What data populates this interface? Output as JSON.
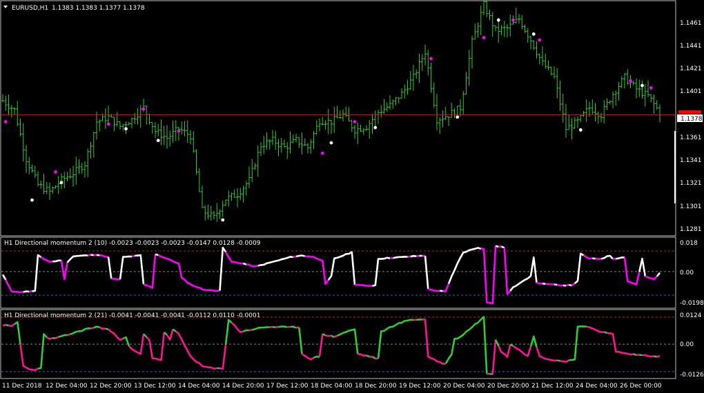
{
  "colors": {
    "background": "#000000",
    "frame": "#c0c0c0",
    "text": "#ffffff",
    "bar": "#32cd32",
    "marker_magenta": "#ff00ff",
    "marker_white": "#ffffff",
    "price_line": "#ff0000",
    "price_label_bg": "#ffffff",
    "dm10_up": "#ffffff",
    "dm10_down": "#ff00ff",
    "dm21_up": "#32cd32",
    "dm21_down": "#ff1493",
    "band_upper": "#ff3333",
    "band_lower": "#1e90ff",
    "zero_line": "#c0c0c0"
  },
  "icons": {
    "menu": "triangle-down-icon"
  },
  "main": {
    "symbol_label": "EURUSD,H1",
    "ohlc": "1.1383 1.1383 1.1377 1.1378",
    "current_price": "1.1378",
    "price_ticks": [
      "1.1461",
      "1.1441",
      "1.1421",
      "1.1401",
      "1.1361",
      "1.1341",
      "1.1321",
      "1.1301",
      "1.1281"
    ]
  },
  "sub1": {
    "title": "H1 Directional momentum 2 (10) -0.0023 -0.0023 -0.0023 -0.0147 0.0128 -0.0009",
    "ticks": [
      "0.018",
      "0.00",
      "-0.0198"
    ]
  },
  "sub2": {
    "title": "H1 Directional momentum 2 (21) -0.0041 -0.0041 -0.0041 -0.0112 0.0110 -0.0001",
    "ticks": [
      "0.0124",
      "0.00",
      "-0.0126"
    ]
  },
  "time_axis": [
    "11 Dec 2018",
    "12 Dec 04:00",
    "12 Dec 20:00",
    "13 Dec 12:00",
    "14 Dec 04:00",
    "14 Dec 20:00",
    "17 Dec 12:00",
    "18 Dec 04:00",
    "18 Dec 20:00",
    "19 Dec 12:00",
    "20 Dec 04:00",
    "20 Dec 20:00",
    "21 Dec 12:00",
    "24 Dec 04:00",
    "26 Dec 00:00"
  ],
  "chart_data": [
    {
      "type": "ohlc",
      "symbol": "EURUSD",
      "timeframe": "H1",
      "ylim": [
        1.1275,
        1.1475
      ],
      "x_tick_labels": [
        "11 Dec 2018",
        "12 Dec 04:00",
        "12 Dec 20:00",
        "13 Dec 12:00",
        "14 Dec 04:00",
        "14 Dec 20:00",
        "17 Dec 12:00",
        "18 Dec 04:00",
        "18 Dec 20:00",
        "19 Dec 12:00",
        "20 Dec 04:00",
        "20 Dec 20:00",
        "21 Dec 12:00",
        "24 Dec 04:00",
        "26 Dec 00:00"
      ],
      "y_tick_labels": [
        "1.1461",
        "1.1441",
        "1.1421",
        "1.1401",
        "1.1361",
        "1.1341",
        "1.1321",
        "1.1301",
        "1.1281"
      ],
      "current_price": 1.1378,
      "path_close": [
        [
          0,
          1.139
        ],
        [
          4,
          1.1382
        ],
        [
          8,
          1.134
        ],
        [
          12,
          1.1318
        ],
        [
          16,
          1.1312
        ],
        [
          20,
          1.1322
        ],
        [
          24,
          1.1328
        ],
        [
          28,
          1.1336
        ],
        [
          32,
          1.1372
        ],
        [
          36,
          1.1376
        ],
        [
          40,
          1.1368
        ],
        [
          44,
          1.1374
        ],
        [
          48,
          1.1384
        ],
        [
          52,
          1.1364
        ],
        [
          56,
          1.1358
        ],
        [
          60,
          1.1366
        ],
        [
          64,
          1.136
        ],
        [
          68,
          1.1296
        ],
        [
          72,
          1.129
        ],
        [
          76,
          1.1306
        ],
        [
          80,
          1.131
        ],
        [
          84,
          1.1322
        ],
        [
          88,
          1.1352
        ],
        [
          92,
          1.1356
        ],
        [
          96,
          1.135
        ],
        [
          100,
          1.1356
        ],
        [
          104,
          1.135
        ],
        [
          108,
          1.1373
        ],
        [
          112,
          1.1372
        ],
        [
          116,
          1.1378
        ],
        [
          120,
          1.1365
        ],
        [
          124,
          1.1368
        ],
        [
          128,
          1.138
        ],
        [
          132,
          1.1386
        ],
        [
          136,
          1.1396
        ],
        [
          140,
          1.141
        ],
        [
          144,
          1.1432
        ],
        [
          148,
          1.1374
        ],
        [
          152,
          1.1378
        ],
        [
          156,
          1.1384
        ],
        [
          160,
          1.144
        ],
        [
          164,
          1.1472
        ],
        [
          168,
          1.145
        ],
        [
          172,
          1.1452
        ],
        [
          176,
          1.146
        ],
        [
          180,
          1.1442
        ],
        [
          184,
          1.1422
        ],
        [
          188,
          1.141
        ],
        [
          192,
          1.1366
        ],
        [
          196,
          1.1372
        ],
        [
          200,
          1.1384
        ],
        [
          204,
          1.1378
        ],
        [
          208,
          1.1396
        ],
        [
          212,
          1.141
        ],
        [
          216,
          1.14
        ],
        [
          220,
          1.1394
        ],
        [
          224,
          1.138
        ]
      ],
      "markers": [
        {
          "type": "magenta",
          "bar": 1,
          "price": 1.1372
        },
        {
          "type": "white",
          "bar": 10,
          "price": 1.1305
        },
        {
          "type": "magenta",
          "bar": 18,
          "price": 1.1329
        },
        {
          "type": "white",
          "bar": 20,
          "price": 1.132
        },
        {
          "type": "magenta",
          "bar": 36,
          "price": 1.137
        },
        {
          "type": "white",
          "bar": 42,
          "price": 1.1366
        },
        {
          "type": "magenta",
          "bar": 48,
          "price": 1.1383
        },
        {
          "type": "white",
          "bar": 53,
          "price": 1.1356
        },
        {
          "type": "magenta",
          "bar": 60,
          "price": 1.1364
        },
        {
          "type": "white",
          "bar": 75,
          "price": 1.1288
        },
        {
          "type": "white",
          "bar": 112,
          "price": 1.1354
        },
        {
          "type": "magenta",
          "bar": 109,
          "price": 1.1345
        },
        {
          "type": "magenta",
          "bar": 120,
          "price": 1.1372
        },
        {
          "type": "white",
          "bar": 127,
          "price": 1.1367
        },
        {
          "type": "magenta",
          "bar": 146,
          "price": 1.1426
        },
        {
          "type": "white",
          "bar": 155,
          "price": 1.1376
        },
        {
          "type": "magenta",
          "bar": 164,
          "price": 1.1444
        },
        {
          "type": "white",
          "bar": 169,
          "price": 1.1459
        },
        {
          "type": "magenta",
          "bar": 174,
          "price": 1.1459
        },
        {
          "type": "white",
          "bar": 181,
          "price": 1.1447
        },
        {
          "type": "magenta",
          "bar": 183,
          "price": 1.1442
        },
        {
          "type": "white",
          "bar": 197,
          "price": 1.1365
        },
        {
          "type": "magenta",
          "bar": 214,
          "price": 1.1407
        },
        {
          "type": "white",
          "bar": 218,
          "price": 1.1403
        },
        {
          "type": "magenta",
          "bar": 221,
          "price": 1.1401
        }
      ]
    },
    {
      "type": "line",
      "title": "H1 Directional momentum 2 (10)",
      "values_shown": [
        -0.0023,
        -0.0023,
        -0.0023,
        -0.0147,
        0.0128,
        -0.0009
      ],
      "ylim": [
        -0.0198,
        0.018
      ],
      "y_tick_labels": [
        "0.018",
        "0.00",
        "-0.0198"
      ],
      "upper_band": 0.0128,
      "lower_band": -0.0147,
      "path": [
        [
          0,
          -0.002
        ],
        [
          3,
          -0.012
        ],
        [
          5,
          -0.0128
        ],
        [
          8,
          -0.0125
        ],
        [
          11,
          -0.0122
        ],
        [
          12,
          0.01
        ],
        [
          16,
          0.006
        ],
        [
          20,
          0.007
        ],
        [
          21,
          -0.005
        ],
        [
          22,
          0.006
        ],
        [
          24,
          0.0095
        ],
        [
          28,
          0.01
        ],
        [
          32,
          0.0106
        ],
        [
          36,
          0.009
        ],
        [
          37,
          -0.0045
        ],
        [
          40,
          -0.005
        ],
        [
          41,
          0.009
        ],
        [
          44,
          0.0095
        ],
        [
          47,
          0.01
        ],
        [
          48,
          -0.008
        ],
        [
          51,
          -0.01
        ],
        [
          52,
          0.011
        ],
        [
          56,
          0.008
        ],
        [
          60,
          0.005
        ],
        [
          61,
          -0.004
        ],
        [
          64,
          -0.008
        ],
        [
          68,
          -0.011
        ],
        [
          72,
          -0.012
        ],
        [
          74,
          -0.0115
        ],
        [
          75,
          0.015
        ],
        [
          78,
          0.006
        ],
        [
          82,
          0.005
        ],
        [
          86,
          0.003
        ],
        [
          90,
          0.005
        ],
        [
          94,
          0.007
        ],
        [
          98,
          0.009
        ],
        [
          102,
          0.01
        ],
        [
          106,
          0.009
        ],
        [
          109,
          0.007
        ],
        [
          110,
          -0.008
        ],
        [
          112,
          -0.003
        ],
        [
          113,
          0.008
        ],
        [
          116,
          0.01
        ],
        [
          119,
          0.012
        ],
        [
          120,
          -0.008
        ],
        [
          124,
          -0.009
        ],
        [
          127,
          -0.0085
        ],
        [
          128,
          0.008
        ],
        [
          132,
          0.0085
        ],
        [
          136,
          0.009
        ],
        [
          140,
          0.0095
        ],
        [
          144,
          0.01
        ],
        [
          145,
          -0.011
        ],
        [
          148,
          -0.012
        ],
        [
          151,
          -0.0125
        ],
        [
          153,
          -0.003
        ],
        [
          155,
          0.005
        ],
        [
          157,
          0.012
        ],
        [
          162,
          0.015
        ],
        [
          164,
          0.014
        ],
        [
          165,
          -0.019
        ],
        [
          167,
          -0.02
        ],
        [
          168,
          0.016
        ],
        [
          171,
          0.015
        ],
        [
          172,
          -0.014
        ],
        [
          174,
          -0.01
        ],
        [
          177,
          -0.006
        ],
        [
          180,
          -0.003
        ],
        [
          181,
          0.009
        ],
        [
          182,
          -0.007
        ],
        [
          186,
          -0.008
        ],
        [
          190,
          -0.0085
        ],
        [
          194,
          -0.0085
        ],
        [
          196,
          -0.006
        ],
        [
          197,
          0.011
        ],
        [
          200,
          0.008
        ],
        [
          204,
          0.008
        ],
        [
          207,
          0.01
        ],
        [
          208,
          0.008
        ],
        [
          212,
          0.009
        ],
        [
          213,
          -0.006
        ],
        [
          216,
          -0.008
        ],
        [
          218,
          0.008
        ],
        [
          219,
          -0.003
        ],
        [
          222,
          -0.005
        ],
        [
          224,
          -0.0009
        ]
      ]
    },
    {
      "type": "line",
      "title": "H1 Directional momentum 2 (21)",
      "values_shown": [
        -0.0041,
        -0.0041,
        -0.0041,
        -0.0112,
        0.011,
        -0.0001
      ],
      "ylim": [
        -0.0126,
        0.0124
      ],
      "y_tick_labels": [
        "0.0124",
        "0.00",
        "-0.0126"
      ],
      "upper_band": 0.011,
      "lower_band": -0.0112,
      "path": [
        [
          0,
          0.0078
        ],
        [
          3,
          0.0072
        ],
        [
          5,
          0.009
        ],
        [
          7,
          -0.009
        ],
        [
          10,
          -0.0105
        ],
        [
          13,
          -0.01
        ],
        [
          14,
          0.004
        ],
        [
          16,
          0.002
        ],
        [
          20,
          0.003
        ],
        [
          24,
          0.0045
        ],
        [
          28,
          0.006
        ],
        [
          32,
          0.007
        ],
        [
          36,
          0.006
        ],
        [
          40,
          0.002
        ],
        [
          42,
          0.003
        ],
        [
          43,
          -0.001
        ],
        [
          45,
          -0.003
        ],
        [
          47,
          -0.004
        ],
        [
          48,
          0.004
        ],
        [
          50,
          0.0015
        ],
        [
          51,
          -0.0055
        ],
        [
          54,
          -0.0065
        ],
        [
          55,
          0.005
        ],
        [
          57,
          0.002
        ],
        [
          58,
          0.006
        ],
        [
          60,
          0.004
        ],
        [
          62,
          -0.0005
        ],
        [
          64,
          -0.005
        ],
        [
          68,
          -0.009
        ],
        [
          72,
          -0.01
        ],
        [
          75,
          -0.01
        ],
        [
          77,
          0.01
        ],
        [
          81,
          0.005
        ],
        [
          85,
          0.006
        ],
        [
          90,
          0.007
        ],
        [
          94,
          0.007
        ],
        [
          98,
          0.0068
        ],
        [
          101,
          0.007
        ],
        [
          102,
          -0.004
        ],
        [
          105,
          -0.006
        ],
        [
          108,
          -0.005
        ],
        [
          109,
          0.004
        ],
        [
          113,
          0.003
        ],
        [
          117,
          0.005
        ],
        [
          120,
          0.006
        ],
        [
          121,
          -0.004
        ],
        [
          125,
          -0.005
        ],
        [
          128,
          -0.006
        ],
        [
          129,
          0.005
        ],
        [
          134,
          0.008
        ],
        [
          139,
          0.01
        ],
        [
          144,
          0.01
        ],
        [
          145,
          -0.005
        ],
        [
          149,
          -0.0075
        ],
        [
          151,
          -0.008
        ],
        [
          153,
          -0.004
        ],
        [
          154,
          0.002
        ],
        [
          156,
          0.003
        ],
        [
          157,
          0.004
        ],
        [
          158,
          0.005
        ],
        [
          161,
          0.008
        ],
        [
          164,
          0.011
        ],
        [
          165,
          -0.012
        ],
        [
          167,
          -0.012
        ],
        [
          168,
          0.002
        ],
        [
          170,
          -0.003
        ],
        [
          172,
          -0.005
        ],
        [
          173,
          0.0
        ],
        [
          176,
          -0.002
        ],
        [
          179,
          -0.005
        ],
        [
          181,
          0.003
        ],
        [
          183,
          -0.005
        ],
        [
          187,
          -0.0065
        ],
        [
          192,
          -0.007
        ],
        [
          195,
          -0.006
        ],
        [
          196,
          0.007
        ],
        [
          200,
          0.007
        ],
        [
          204,
          0.005
        ],
        [
          208,
          0.004
        ],
        [
          209,
          -0.003
        ],
        [
          213,
          -0.004
        ],
        [
          218,
          -0.0045
        ],
        [
          224,
          -0.005
        ]
      ]
    }
  ]
}
